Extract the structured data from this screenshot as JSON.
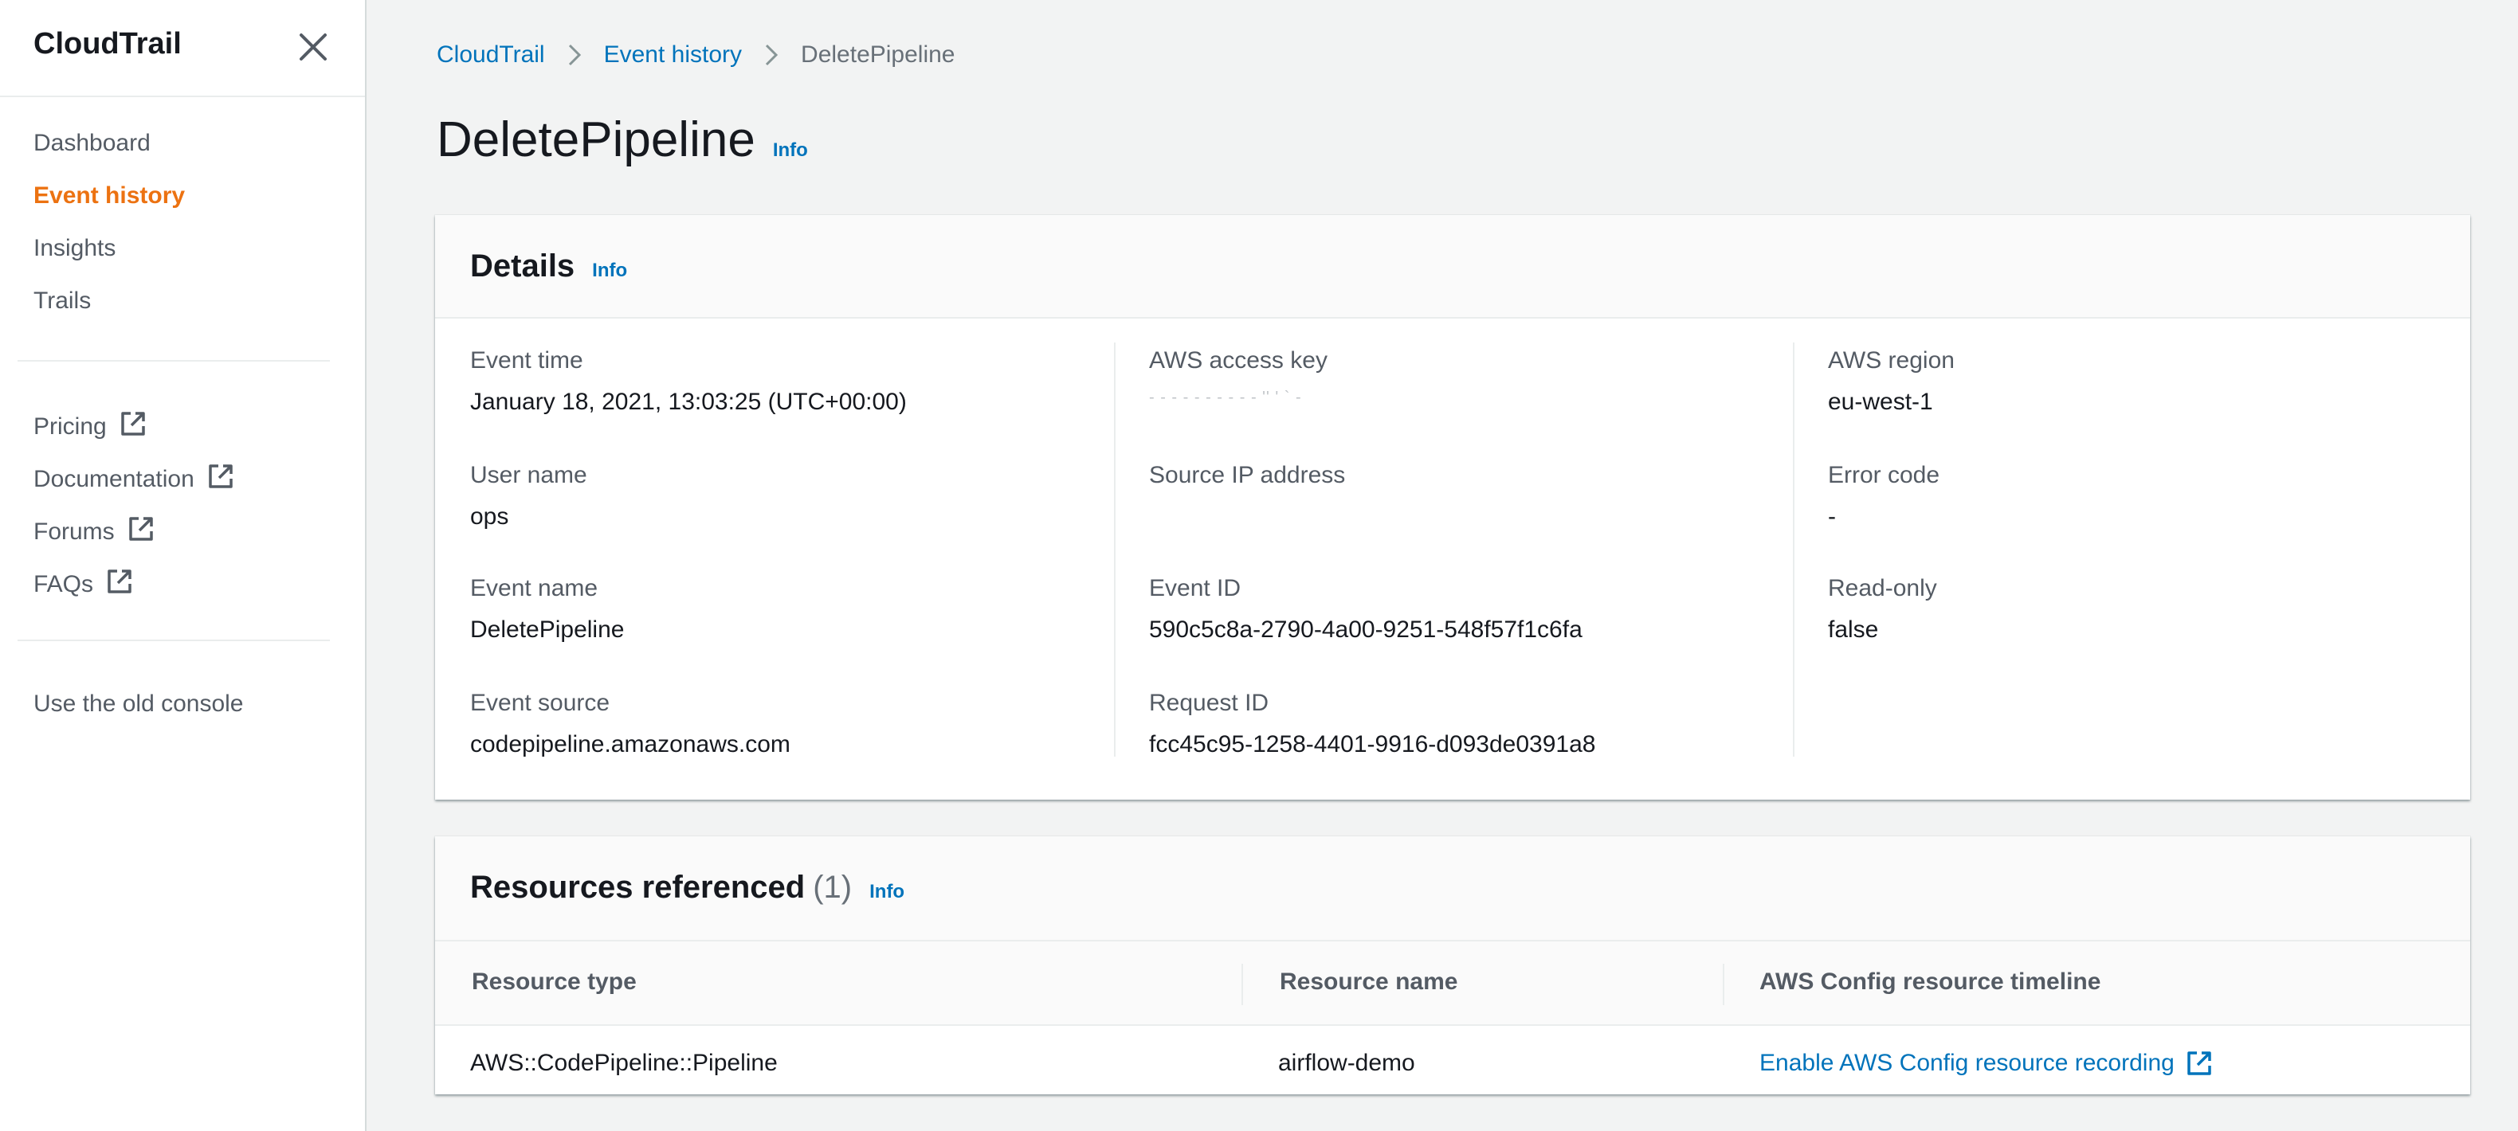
{
  "sidebar": {
    "title": "CloudTrail",
    "nav": [
      {
        "label": "Dashboard",
        "active": false
      },
      {
        "label": "Event history",
        "active": true
      },
      {
        "label": "Insights",
        "active": false
      },
      {
        "label": "Trails",
        "active": false
      }
    ],
    "external_links": [
      {
        "label": "Pricing",
        "icon": "external-link-icon"
      },
      {
        "label": "Documentation",
        "icon": "external-link-icon"
      },
      {
        "label": "Forums",
        "icon": "external-link-icon"
      },
      {
        "label": "FAQs",
        "icon": "external-link-icon"
      }
    ],
    "old_console": "Use the old console",
    "active_color": "#ec7211"
  },
  "breadcrumb": {
    "items": [
      "CloudTrail",
      "Event history"
    ],
    "current": "DeletePipeline"
  },
  "page": {
    "title": "DeletePipeline",
    "info": "Info"
  },
  "details": {
    "title": "Details",
    "info": "Info",
    "columns": [
      [
        {
          "label": "Event time",
          "value": "January 18, 2021, 13:03:25 (UTC+00:00)"
        },
        {
          "label": "User name",
          "value": "ops"
        },
        {
          "label": "Event name",
          "value": "DeletePipeline"
        },
        {
          "label": "Event source",
          "value": "codepipeline.amazonaws.com"
        }
      ],
      [
        {
          "label": "AWS access key",
          "value": "- - - - - - - - - - '' ' ` -"
        },
        {
          "label": "Source IP address",
          "value": ""
        },
        {
          "label": "Event ID",
          "value": "590c5c8a-2790-4a00-9251-548f57f1c6fa"
        },
        {
          "label": "Request ID",
          "value": "fcc45c95-1258-4401-9916-d093de0391a8"
        }
      ],
      [
        {
          "label": "AWS region",
          "value": "eu-west-1"
        },
        {
          "label": "Error code",
          "value": "-"
        },
        {
          "label": "Read-only",
          "value": "false"
        }
      ]
    ]
  },
  "resources": {
    "title": "Resources referenced",
    "count": "(1)",
    "info": "Info",
    "headers": [
      "Resource type",
      "Resource name",
      "AWS Config resource timeline"
    ],
    "rows": [
      {
        "type": "AWS::CodePipeline::Pipeline",
        "name": "airflow-demo",
        "timeline_link": "Enable AWS Config resource recording"
      }
    ]
  },
  "colors": {
    "link": "#0073bb",
    "text": "#16191f",
    "muted": "#545b64",
    "background": "#f2f3f3"
  }
}
